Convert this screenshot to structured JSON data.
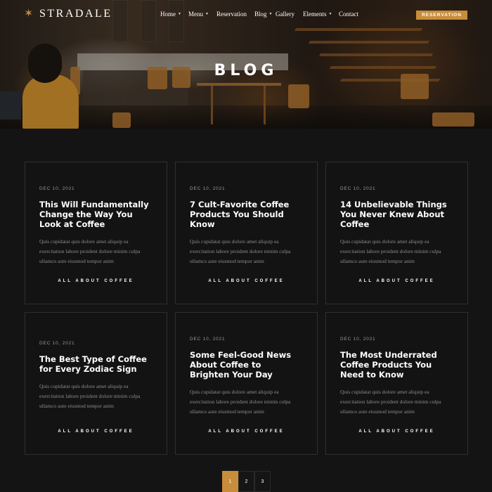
{
  "brand": {
    "name": "STRADALE",
    "icon": "star-compass-icon",
    "accent_color": "#c78d3b"
  },
  "nav": {
    "items": [
      {
        "label": "Home",
        "has_caret": true
      },
      {
        "label": "Menu",
        "has_caret": true
      },
      {
        "label": "Reservation",
        "has_caret": false
      },
      {
        "label": "Blog",
        "has_caret": true
      },
      {
        "label": "Gallery",
        "has_caret": false
      },
      {
        "label": "Elements",
        "has_caret": true
      },
      {
        "label": "Contact",
        "has_caret": false
      }
    ],
    "cta_label": "RESERVATION"
  },
  "hero": {
    "title": "BLOG"
  },
  "posts": [
    {
      "date": "DEC 10, 2021",
      "title": "This Will Fundamentally Change the Way You Look at Coffee",
      "excerpt": "Quis cupidatat quis dolore amet aliquip ea exercitation labore proident dolore minim culpa ullamco aute eiusmod tempor anim",
      "category": "ALL ABOUT COFFEE"
    },
    {
      "date": "DEC 10, 2021",
      "title": "7 Cult-Favorite Coffee Products You Should Know",
      "excerpt": "Quis cupidatat quis dolore amet aliquip ea exercitation labore proident dolore minim culpa ullamco aute eiusmod tempor anim",
      "category": "ALL ABOUT COFFEE"
    },
    {
      "date": "DEC 10, 2021",
      "title": "14 Unbelievable Things You Never Knew About Coffee",
      "excerpt": "Quis cupidatat quis dolore amet aliquip ea exercitation labore proident dolore minim culpa ullamco aute eiusmod tempor anim",
      "category": "ALL ABOUT COFFEE"
    },
    {
      "date": "DEC 10, 2021",
      "title": "The Best Type of Coffee for Every Zodiac Sign",
      "excerpt": "Quis cupidatat quis dolore amet aliquip ea exercitation labore proident dolore minim culpa ullamco aute eiusmod tempor anim",
      "category": "ALL ABOUT COFFEE"
    },
    {
      "date": "DEC 10, 2021",
      "title": "Some Feel-Good News About Coffee to Brighten Your Day",
      "excerpt": "Quis cupidatat quis dolore amet aliquip ea exercitation labore proident dolore minim culpa ullamco aute eiusmod tempor anim",
      "category": "ALL ABOUT COFFEE"
    },
    {
      "date": "DEC 10, 2021",
      "title": "The Most Underrated Coffee Products You Need to Know",
      "excerpt": "Quis cupidatat quis dolore amet aliquip ea exercitation labore proident dolore minim culpa ullamco aute eiusmod tempor anim",
      "category": "ALL ABOUT COFFEE"
    }
  ],
  "pagination": {
    "pages": [
      "1",
      "2",
      "3"
    ],
    "current": "1"
  }
}
